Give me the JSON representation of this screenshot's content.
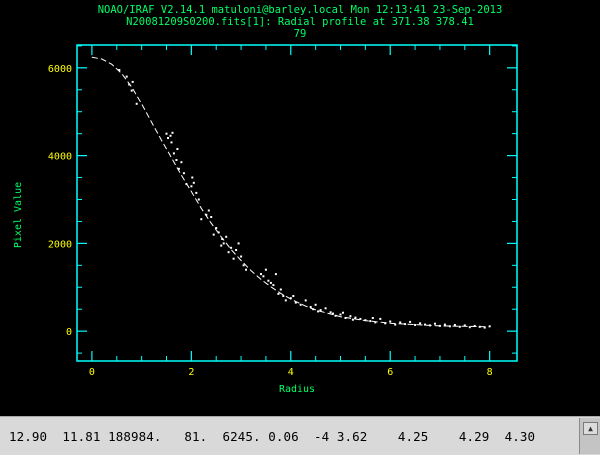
{
  "header": {
    "line1": "NOAO/IRAF V2.14.1 matuloni@barley.local Mon 12:13:41 23-Sep-2013",
    "line2": "N20081209S0200.fits[1]: Radial profile at 371.38 378.41",
    "line3": "79"
  },
  "status": {
    "readout": "12.90  11.81 188984.   81.  6245. 0.06  -4 3.62    4.25    4.29  4.30"
  },
  "colors": {
    "background": "#000000",
    "frame": "#00ffff",
    "tick_labels": "#ffff00",
    "text": "#00ff66",
    "points": "#ffffff"
  },
  "chart_data": {
    "type": "scatter",
    "title": "",
    "xlabel": "Radius",
    "ylabel": "Pixel Value",
    "xlim": [
      -0.3,
      8.55
    ],
    "ylim": [
      -680,
      6520
    ],
    "xticks": [
      0,
      2,
      4,
      6,
      8
    ],
    "yticks": [
      0,
      2000,
      4000,
      6000
    ],
    "grid": false,
    "fit_curve": {
      "style": "dashed",
      "x": [
        0,
        0.2,
        0.4,
        0.6,
        0.8,
        1.0,
        1.2,
        1.4,
        1.6,
        1.8,
        2.0,
        2.2,
        2.4,
        2.6,
        2.8,
        3.0,
        3.2,
        3.4,
        3.6,
        3.8,
        4.0,
        4.2,
        4.4,
        4.6,
        4.8,
        5.0,
        5.5,
        6.0,
        6.5,
        7.0,
        7.5,
        8.0
      ],
      "y": [
        6240,
        6200,
        6080,
        5870,
        5560,
        5180,
        4760,
        4350,
        3950,
        3550,
        3180,
        2800,
        2460,
        2150,
        1860,
        1610,
        1380,
        1180,
        1010,
        860,
        730,
        620,
        520,
        450,
        390,
        330,
        240,
        180,
        150,
        120,
        110,
        100
      ]
    },
    "points": {
      "x": [
        0.55,
        0.7,
        0.75,
        0.8,
        0.82,
        0.9,
        1.5,
        1.53,
        1.58,
        1.6,
        1.62,
        1.65,
        1.7,
        1.72,
        1.75,
        1.8,
        1.85,
        1.9,
        2.0,
        2.02,
        2.05,
        2.1,
        2.15,
        2.2,
        2.3,
        2.35,
        2.4,
        2.45,
        2.5,
        2.55,
        2.6,
        2.62,
        2.65,
        2.7,
        2.75,
        2.8,
        2.85,
        2.9,
        2.95,
        3.0,
        3.05,
        3.1,
        3.4,
        3.45,
        3.5,
        3.55,
        3.6,
        3.65,
        3.7,
        3.75,
        3.8,
        3.85,
        3.9,
        4.0,
        4.05,
        4.1,
        4.2,
        4.3,
        4.4,
        4.45,
        4.5,
        4.55,
        4.6,
        4.7,
        4.8,
        4.85,
        4.9,
        5.0,
        5.05,
        5.1,
        5.2,
        5.25,
        5.3,
        5.4,
        5.5,
        5.6,
        5.65,
        5.7,
        5.8,
        5.9,
        6.0,
        6.1,
        6.2,
        6.3,
        6.4,
        6.5,
        6.6,
        6.7,
        6.8,
        6.9,
        7.0,
        7.1,
        7.2,
        7.3,
        7.4,
        7.5,
        7.6,
        7.7,
        7.8,
        7.9,
        8.0
      ],
      "y": [
        5950,
        5800,
        5620,
        5480,
        5680,
        5180,
        4500,
        4400,
        4450,
        4300,
        4520,
        4050,
        3900,
        4150,
        3700,
        3850,
        3600,
        3350,
        3300,
        3500,
        3380,
        3150,
        3000,
        2550,
        2650,
        2750,
        2600,
        2200,
        2350,
        2250,
        1950,
        2100,
        2000,
        2150,
        1800,
        1900,
        1650,
        1850,
        2000,
        1700,
        1500,
        1400,
        1300,
        1250,
        1400,
        1150,
        1100,
        1050,
        1300,
        850,
        950,
        800,
        700,
        750,
        800,
        650,
        600,
        700,
        550,
        500,
        600,
        450,
        480,
        520,
        430,
        400,
        350,
        380,
        420,
        300,
        340,
        260,
        310,
        280,
        250,
        230,
        300,
        200,
        280,
        180,
        220,
        150,
        200,
        160,
        210,
        140,
        180,
        150,
        130,
        170,
        120,
        150,
        110,
        140,
        100,
        130,
        90,
        120,
        100,
        80,
        110
      ]
    }
  }
}
